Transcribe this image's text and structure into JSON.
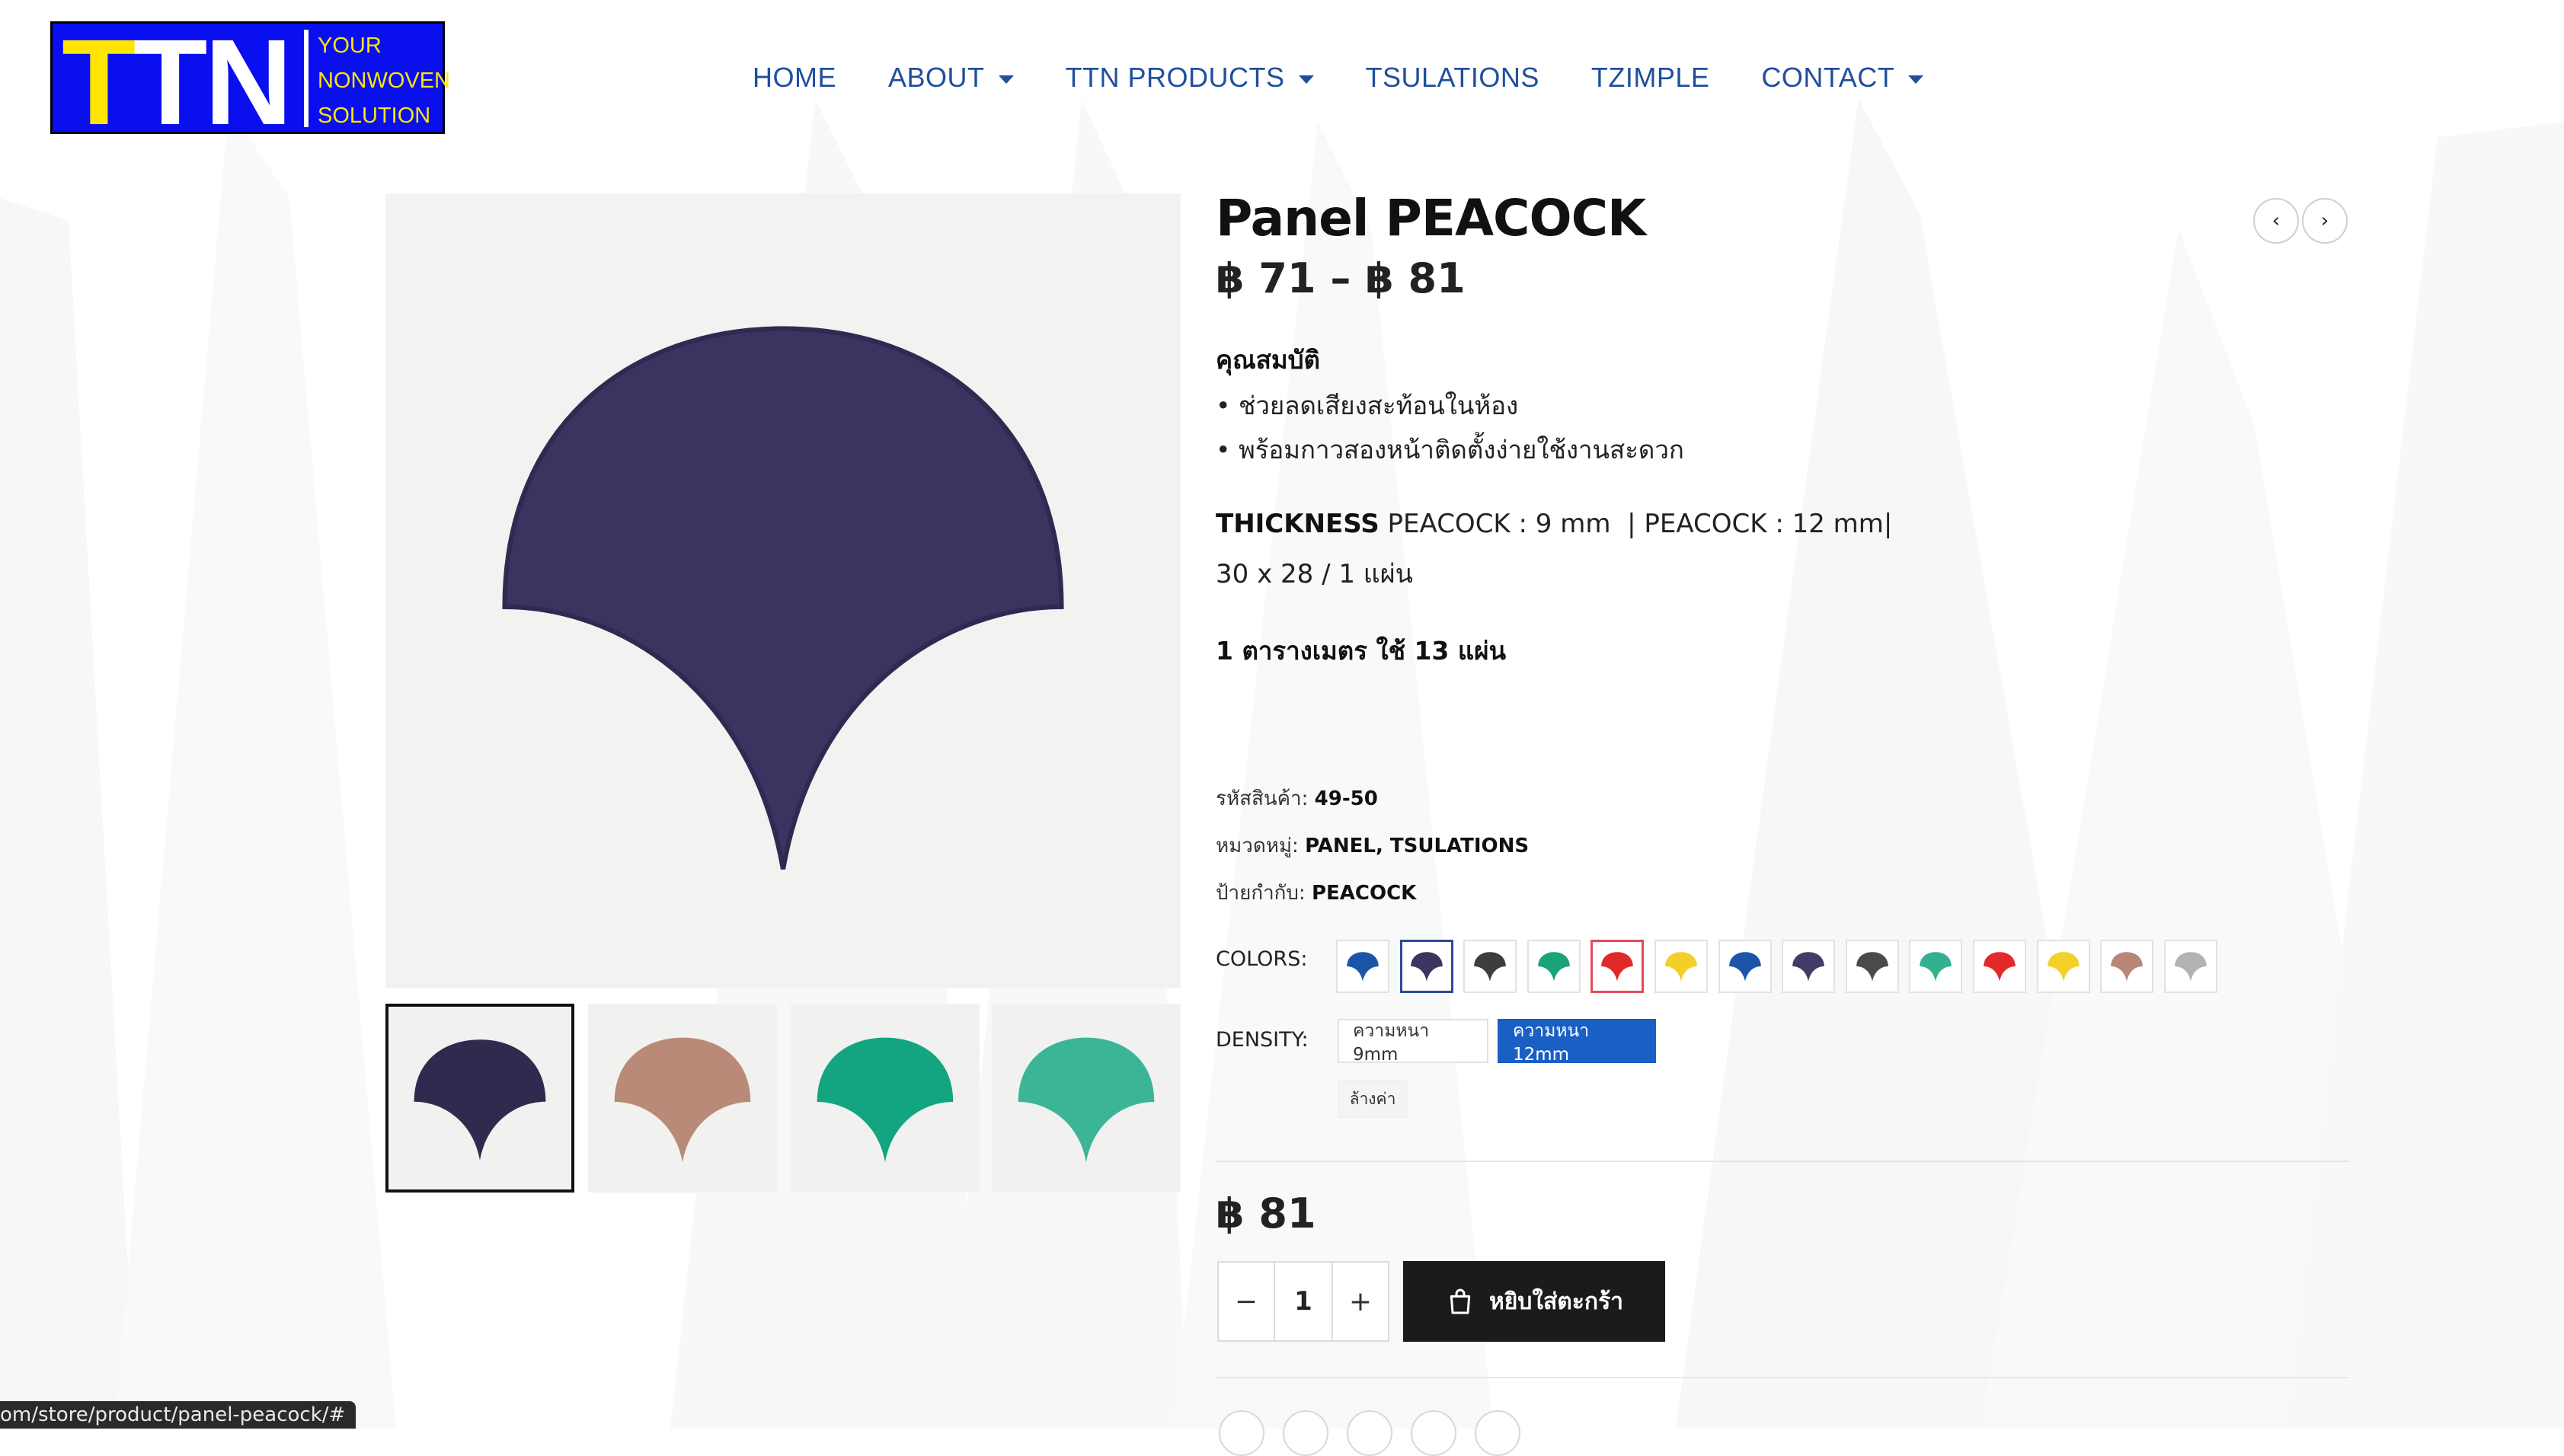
{
  "header": {
    "logo": {
      "mark_t": "T",
      "mark_tn": "TN",
      "tagline": [
        "YOUR",
        "NONWOVEN",
        "SOLUTION"
      ]
    },
    "nav": [
      {
        "label": "HOME",
        "has_dropdown": false
      },
      {
        "label": "ABOUT",
        "has_dropdown": true
      },
      {
        "label": "TTN PRODUCTS",
        "has_dropdown": true
      },
      {
        "label": "TSULATIONS",
        "has_dropdown": false
      },
      {
        "label": "TZIMPLE",
        "has_dropdown": false
      },
      {
        "label": "CONTACT",
        "has_dropdown": true
      }
    ],
    "nav_color": "#1f4f9e"
  },
  "product": {
    "title": "Panel PEACOCK",
    "price_range": "฿ 71 – ฿ 81",
    "properties_heading": "คุณสมบัติ",
    "properties": [
      "• ช่วยลดเสียงสะท้อนในห้อง",
      "• พร้อมกาวสองหน้าติดตั้งง่ายใช้งานสะดวก"
    ],
    "thickness_label": "THICKNESS",
    "thickness_value": " PEACOCK : 9 mm  | PEACOCK : 12 mm|",
    "dimensions": "30 x 28 / 1 แผ่น",
    "coverage": "1 ตารางเมตร ใช้ 13 แผ่น",
    "meta": {
      "sku_label": "รหัสสินค้า: ",
      "sku_value": "49-50",
      "category_label": "หมวดหมู่: ",
      "category_value": "PANEL, TSULATIONS",
      "tag_label": "ป้ายกำกับ: ",
      "tag_value": "PEACOCK"
    },
    "colors_label": "COLORS:",
    "colors": [
      {
        "name": "blue",
        "hex": "#1c55a8"
      },
      {
        "name": "navy",
        "hex": "#3b3560",
        "selected": true
      },
      {
        "name": "charcoal",
        "hex": "#3d3d3d"
      },
      {
        "name": "green",
        "hex": "#1aa27a"
      },
      {
        "name": "red",
        "hex": "#e02a2a",
        "hover": true
      },
      {
        "name": "yellow",
        "hex": "#f3cf2a"
      },
      {
        "name": "blue",
        "hex": "#1c55a8"
      },
      {
        "name": "navy",
        "hex": "#423c66"
      },
      {
        "name": "charcoal",
        "hex": "#4a4a4a"
      },
      {
        "name": "teal",
        "hex": "#33b08f"
      },
      {
        "name": "red",
        "hex": "#e32a2a"
      },
      {
        "name": "yellow",
        "hex": "#f5cf2c"
      },
      {
        "name": "tan",
        "hex": "#b88775"
      },
      {
        "name": "light-grey",
        "hex": "#b3b3b3"
      }
    ],
    "density_label": "DENSITY:",
    "density_options": [
      "ความหนา 9mm",
      "ความหนา 12mm"
    ],
    "density_selected": "ความหนา 12mm",
    "clear_label": "ล้างค่า",
    "current_price": "฿ 81",
    "quantity": "1",
    "qty_minus": "−",
    "qty_plus": "+",
    "add_to_cart_label": "หยิบใส่ตะกร้า",
    "nav_prev": "‹",
    "nav_next": "›"
  },
  "gallery": {
    "main_color": "#3a3461",
    "thumbnails": [
      {
        "color": "#2f2b4f",
        "active": true
      },
      {
        "color": "#b98a77",
        "active": false
      },
      {
        "color": "#13a57f",
        "active": false
      },
      {
        "color": "#3cb597",
        "active": false
      }
    ]
  },
  "status_bar": {
    "url": "om/store/product/panel-peacock/#"
  }
}
